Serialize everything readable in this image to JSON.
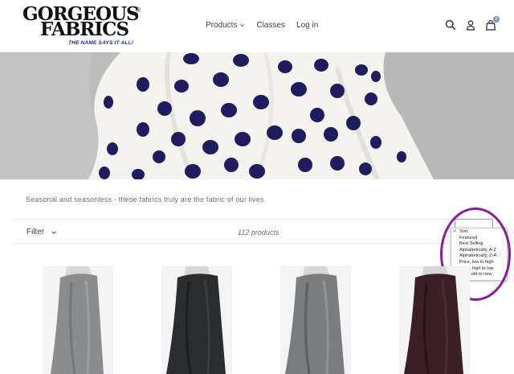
{
  "header": {
    "logo": {
      "line1": "GORGEOUS",
      "line2": "FABRICS",
      "registered": "®",
      "tagline": "THE NAME SAYS IT ALL!"
    },
    "nav": [
      {
        "label": "Products",
        "has_dropdown": true
      },
      {
        "label": "Classes",
        "has_dropdown": false
      },
      {
        "label": "Log in",
        "has_dropdown": false
      }
    ],
    "icons": [
      "search-icon",
      "user-icon",
      "cart-icon"
    ],
    "cart_count": "0"
  },
  "hero": {
    "fabric_color": "#f4f3ef",
    "dot_color": "#1f1d5e"
  },
  "collection": {
    "description": "Seasonal and seasonless - these fabrics truly are the fabric of our lives.",
    "filter_label": "Filter",
    "product_count": "112 products"
  },
  "sort": {
    "selected": "Sort",
    "options": [
      "Sort",
      "Featured",
      "Best Selling",
      "Alphabetically, A-Z",
      "Alphabetically, Z-A",
      "Price, low to high",
      "Price, high to low",
      "Date, old to new"
    ]
  },
  "annotation_color": "#8b1ca0",
  "products": [
    {
      "color": "#8a8c8e"
    },
    {
      "color": "#2a2c30"
    },
    {
      "color": "#7a7c80"
    },
    {
      "color": "#3a2024"
    }
  ]
}
